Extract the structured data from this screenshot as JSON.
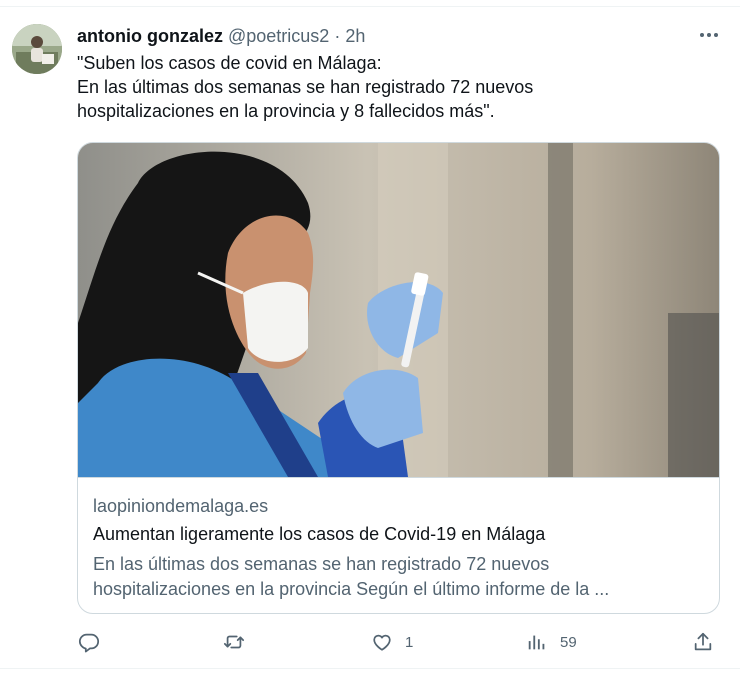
{
  "tweet": {
    "author_name": "antonio gonzalez",
    "author_handle": "@poetricus2",
    "separator": "·",
    "time": "2h",
    "text_lines": [
      "\"Suben los casos de covid en Málaga:",
      "En las últimas dos semanas se han registrado 72 nuevos",
      "hospitalizaciones en la provincia y 8 fallecidos más\"."
    ]
  },
  "card": {
    "domain": "laopiniondemalaga.es",
    "title": "Aumentan ligeramente los casos de Covid-19 en Málaga",
    "description_lines": [
      "En las últimas dos semanas se han registrado 72 nuevos",
      "hospitalizaciones en la provincia Según el último informe de la ..."
    ]
  },
  "actions": {
    "reply_count": "",
    "retweet_count": "",
    "like_count": "1",
    "views_count": "59"
  },
  "icons": {
    "more": "more-horizontal-icon",
    "reply": "reply-icon",
    "retweet": "retweet-icon",
    "like": "heart-icon",
    "views": "analytics-icon",
    "share": "share-icon"
  },
  "colors": {
    "text_primary": "#0f1419",
    "text_secondary": "#536471",
    "border": "#cfd9de"
  }
}
